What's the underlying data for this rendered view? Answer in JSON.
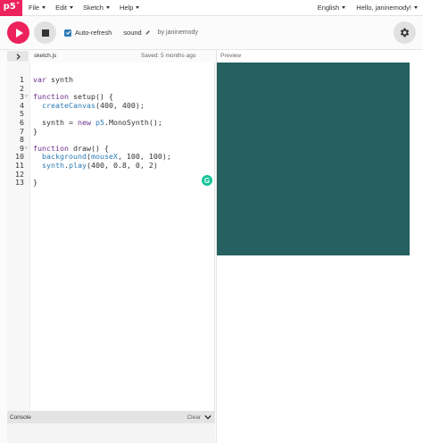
{
  "nav": {
    "logo": "p5",
    "logo_sup": "*",
    "menu": [
      "File",
      "Edit",
      "Sketch",
      "Help"
    ],
    "language": "English",
    "greeting": "Hello, janinemody!"
  },
  "toolbar": {
    "autorefresh_label": "Auto-refresh",
    "autorefresh_checked": true,
    "sketch_name": "sound",
    "owner": "by janinemody"
  },
  "editor": {
    "file_name": "sketch.js",
    "saved_status": "Saved: 5 months ago",
    "code_lines": [
      "var synth",
      "",
      "function setup() {",
      "  createCanvas(400, 400);",
      "",
      "  synth = new p5.MonoSynth();",
      "}",
      "",
      "function draw() {",
      "  background(mouseX, 100, 100);",
      "  synth.play(400, 0.8, 0, 2)",
      "",
      "}"
    ],
    "line_numbers": [
      "1",
      "2",
      "3",
      "4",
      "5",
      "6",
      "7",
      "8",
      "9",
      "10",
      "11",
      "12",
      "13"
    ]
  },
  "preview": {
    "label": "Preview",
    "canvas_color": "#266060"
  },
  "console": {
    "title": "Console",
    "clear_label": "Clear"
  },
  "colors": {
    "accent": "#ed225d",
    "checkbox": "#2d7bb6",
    "grammarly": "#15c39a"
  },
  "icons": {
    "play": "play-icon",
    "stop": "stop-icon",
    "gear": "gear-icon",
    "pencil": "pencil-icon",
    "chevron_right": "chevron-right-icon",
    "chevron_down": "chevron-down-icon",
    "grammarly": "grammarly-icon"
  }
}
